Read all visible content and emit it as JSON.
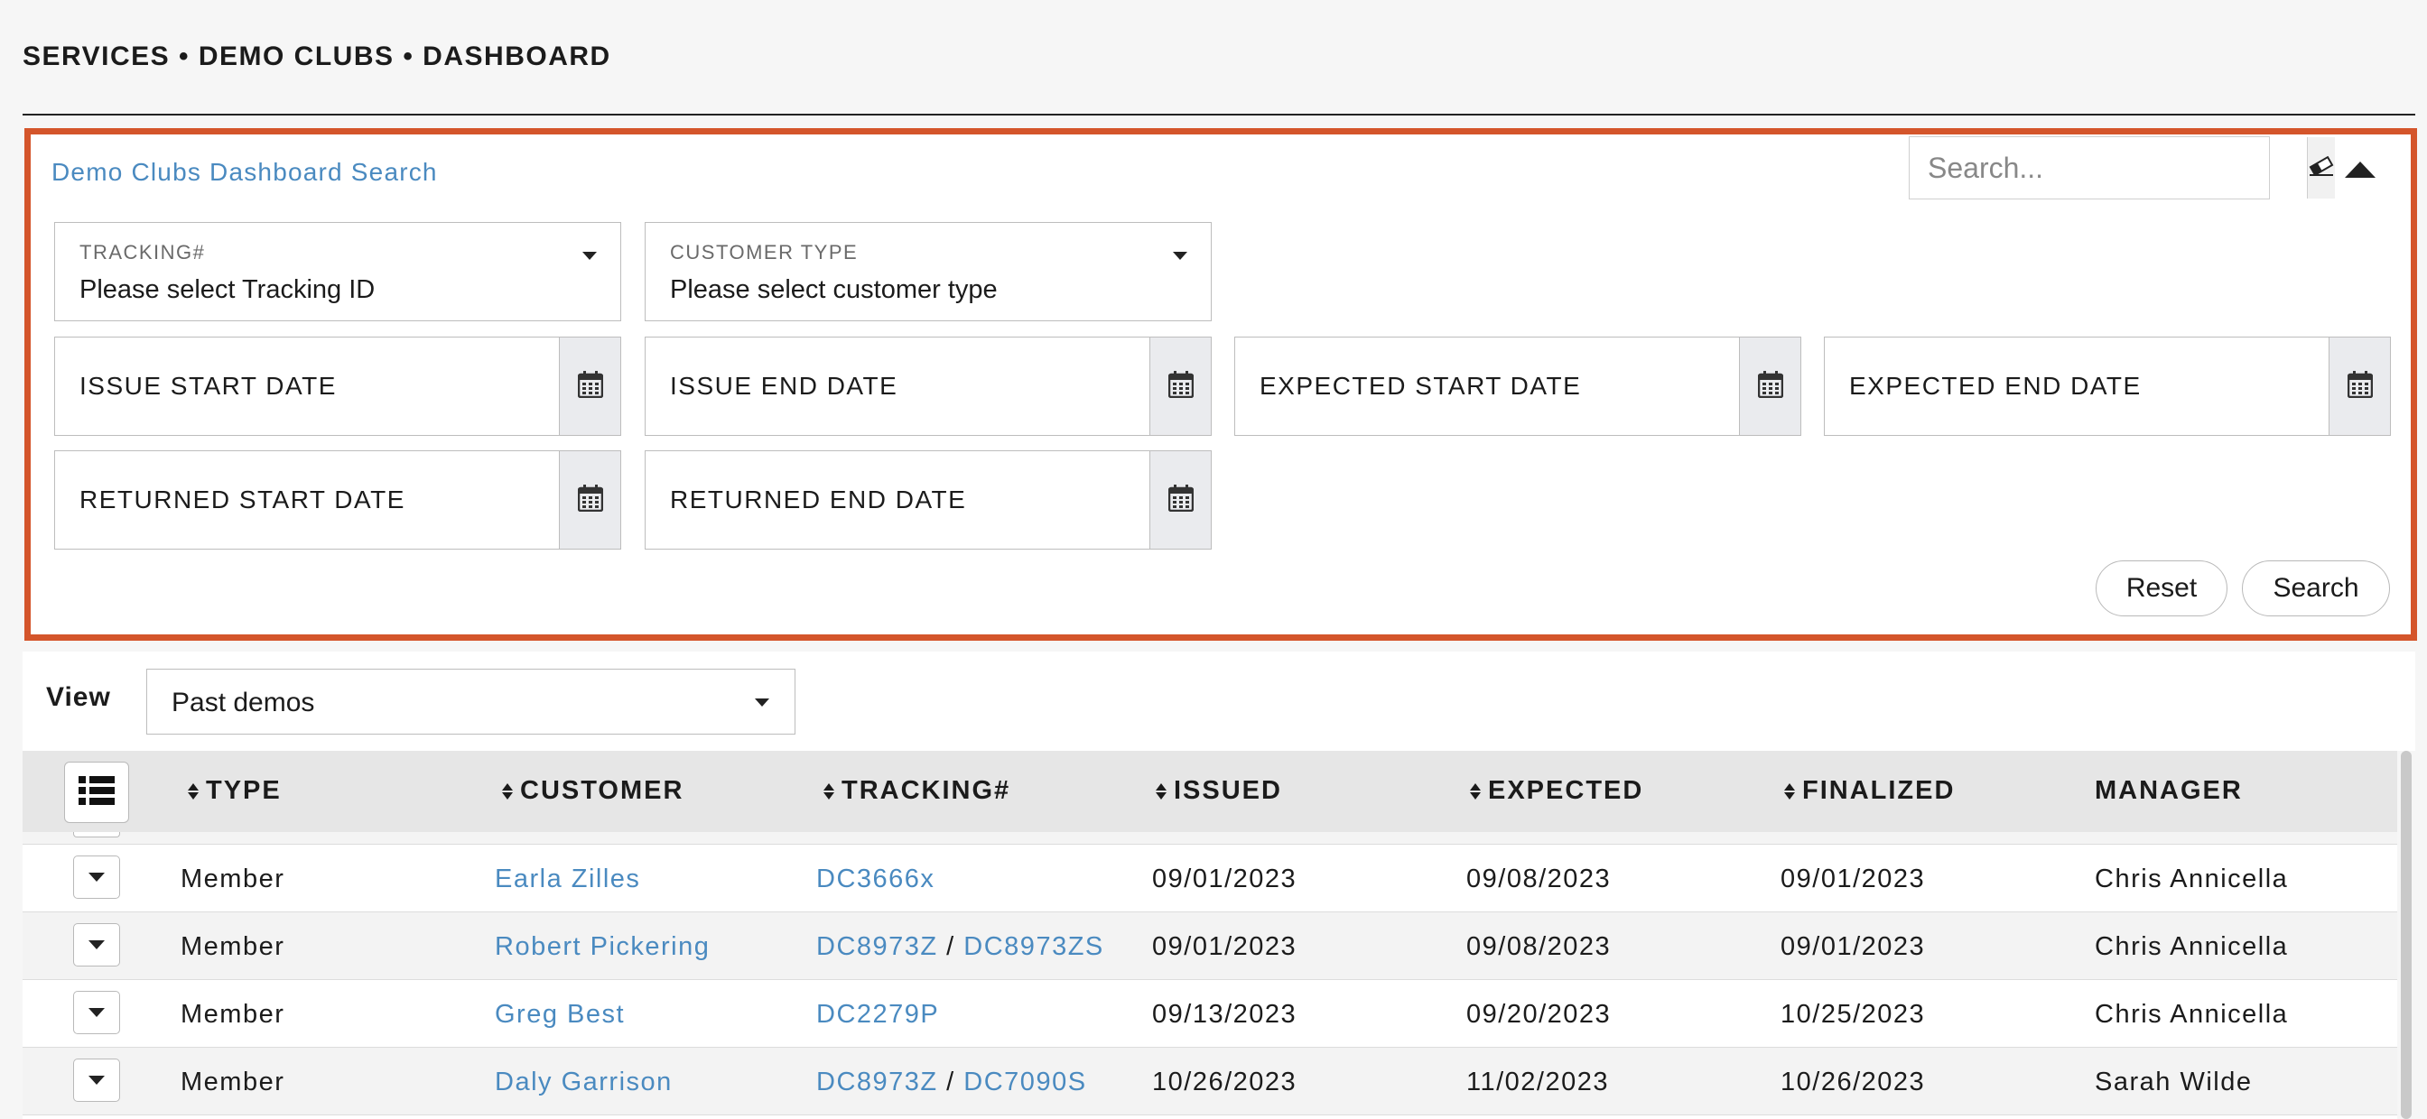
{
  "breadcrumb": "SERVICES • DEMO CLUBS • DASHBOARD",
  "search_panel": {
    "title": "Demo Clubs Dashboard Search",
    "quick_search_placeholder": "Search...",
    "tracking": {
      "label": "TRACKING#",
      "value": "Please select Tracking ID"
    },
    "customer_type": {
      "label": "CUSTOMER TYPE",
      "value": "Please select customer type"
    },
    "dates": {
      "issue_start": "ISSUE START DATE",
      "issue_end": "ISSUE END DATE",
      "expected_start": "EXPECTED START DATE",
      "expected_end": "EXPECTED END DATE",
      "returned_start": "RETURNED START DATE",
      "returned_end": "RETURNED END DATE"
    },
    "reset_label": "Reset",
    "search_label": "Search",
    "accent_color": "#d4552b",
    "icons": {
      "clear": "eraser-icon",
      "collapse": "collapse-up-icon",
      "date": "calendar-icon"
    }
  },
  "view": {
    "label": "View",
    "value": "Past demos"
  },
  "table": {
    "columns": {
      "type": "TYPE",
      "customer": "CUSTOMER",
      "tracking": "TRACKING#",
      "issued": "ISSUED",
      "expected": "EXPECTED",
      "finalized": "FINALIZED",
      "manager": "MANAGER"
    },
    "link_color": "#4a8ac0",
    "rows": [
      {
        "type": "Member",
        "customer": "Earla Zilles",
        "tracking_1": "DC3666x",
        "tracking_2": "",
        "issued": "09/01/2023",
        "expected": "09/08/2023",
        "finalized": "09/01/2023",
        "manager": "Chris Annicella"
      },
      {
        "type": "Member",
        "customer": "Robert Pickering",
        "tracking_1": "DC8973Z",
        "tracking_2": "DC8973ZS",
        "issued": "09/01/2023",
        "expected": "09/08/2023",
        "finalized": "09/01/2023",
        "manager": "Chris Annicella"
      },
      {
        "type": "Member",
        "customer": "Greg Best",
        "tracking_1": "DC2279P",
        "tracking_2": "",
        "issued": "09/13/2023",
        "expected": "09/20/2023",
        "finalized": "10/25/2023",
        "manager": "Chris Annicella"
      },
      {
        "type": "Member",
        "customer": "Daly Garrison",
        "tracking_1": "DC8973Z",
        "tracking_2": "DC7090S",
        "issued": "10/26/2023",
        "expected": "11/02/2023",
        "finalized": "10/26/2023",
        "manager": "Sarah Wilde"
      }
    ]
  }
}
